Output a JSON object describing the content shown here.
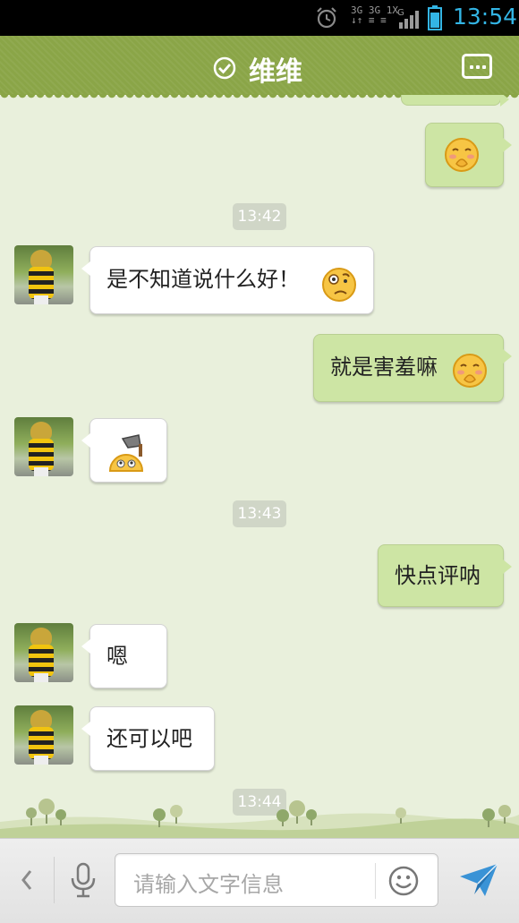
{
  "status_bar": {
    "network_top": "3G 3G 1X",
    "network_bottom": "↓↑ ≡ ≡",
    "network_g": "G",
    "time": "13:54"
  },
  "header": {
    "title": "维维",
    "online_icon": "check-circle-icon",
    "more_icon": "more-icon"
  },
  "messages": [
    {
      "id": "m1",
      "type": "image",
      "direction": "out",
      "emoji": "shy-emoji"
    },
    {
      "id": "t1",
      "type": "timestamp",
      "text": "13:42"
    },
    {
      "id": "m2",
      "type": "text",
      "direction": "in",
      "text": "是不知道说什么好！",
      "emoji": "confused-emoji"
    },
    {
      "id": "m3",
      "type": "text",
      "direction": "out",
      "text": "就是害羞嘛",
      "emoji": "shy-emoji"
    },
    {
      "id": "m4",
      "type": "image",
      "direction": "in",
      "emoji": "hammer-emoji"
    },
    {
      "id": "t2",
      "type": "timestamp",
      "text": "13:43"
    },
    {
      "id": "m5",
      "type": "text",
      "direction": "out",
      "text": "快点评呐"
    },
    {
      "id": "m6",
      "type": "text",
      "direction": "in",
      "text": "嗯"
    },
    {
      "id": "m7",
      "type": "text",
      "direction": "in",
      "text": "还可以吧"
    },
    {
      "id": "t3",
      "type": "timestamp",
      "text": "13:44"
    }
  ],
  "input_bar": {
    "placeholder": "请输入文字信息",
    "back_icon": "chevron-left-icon",
    "voice_icon": "microphone-icon",
    "emoji_icon": "smiley-icon",
    "send_icon": "send-icon"
  },
  "colors": {
    "header": "#8aa547",
    "chat_background": "#e9f0dc",
    "outgoing_bubble": "#cde5a4",
    "incoming_bubble": "#ffffff",
    "clock": "#33b5e5"
  }
}
